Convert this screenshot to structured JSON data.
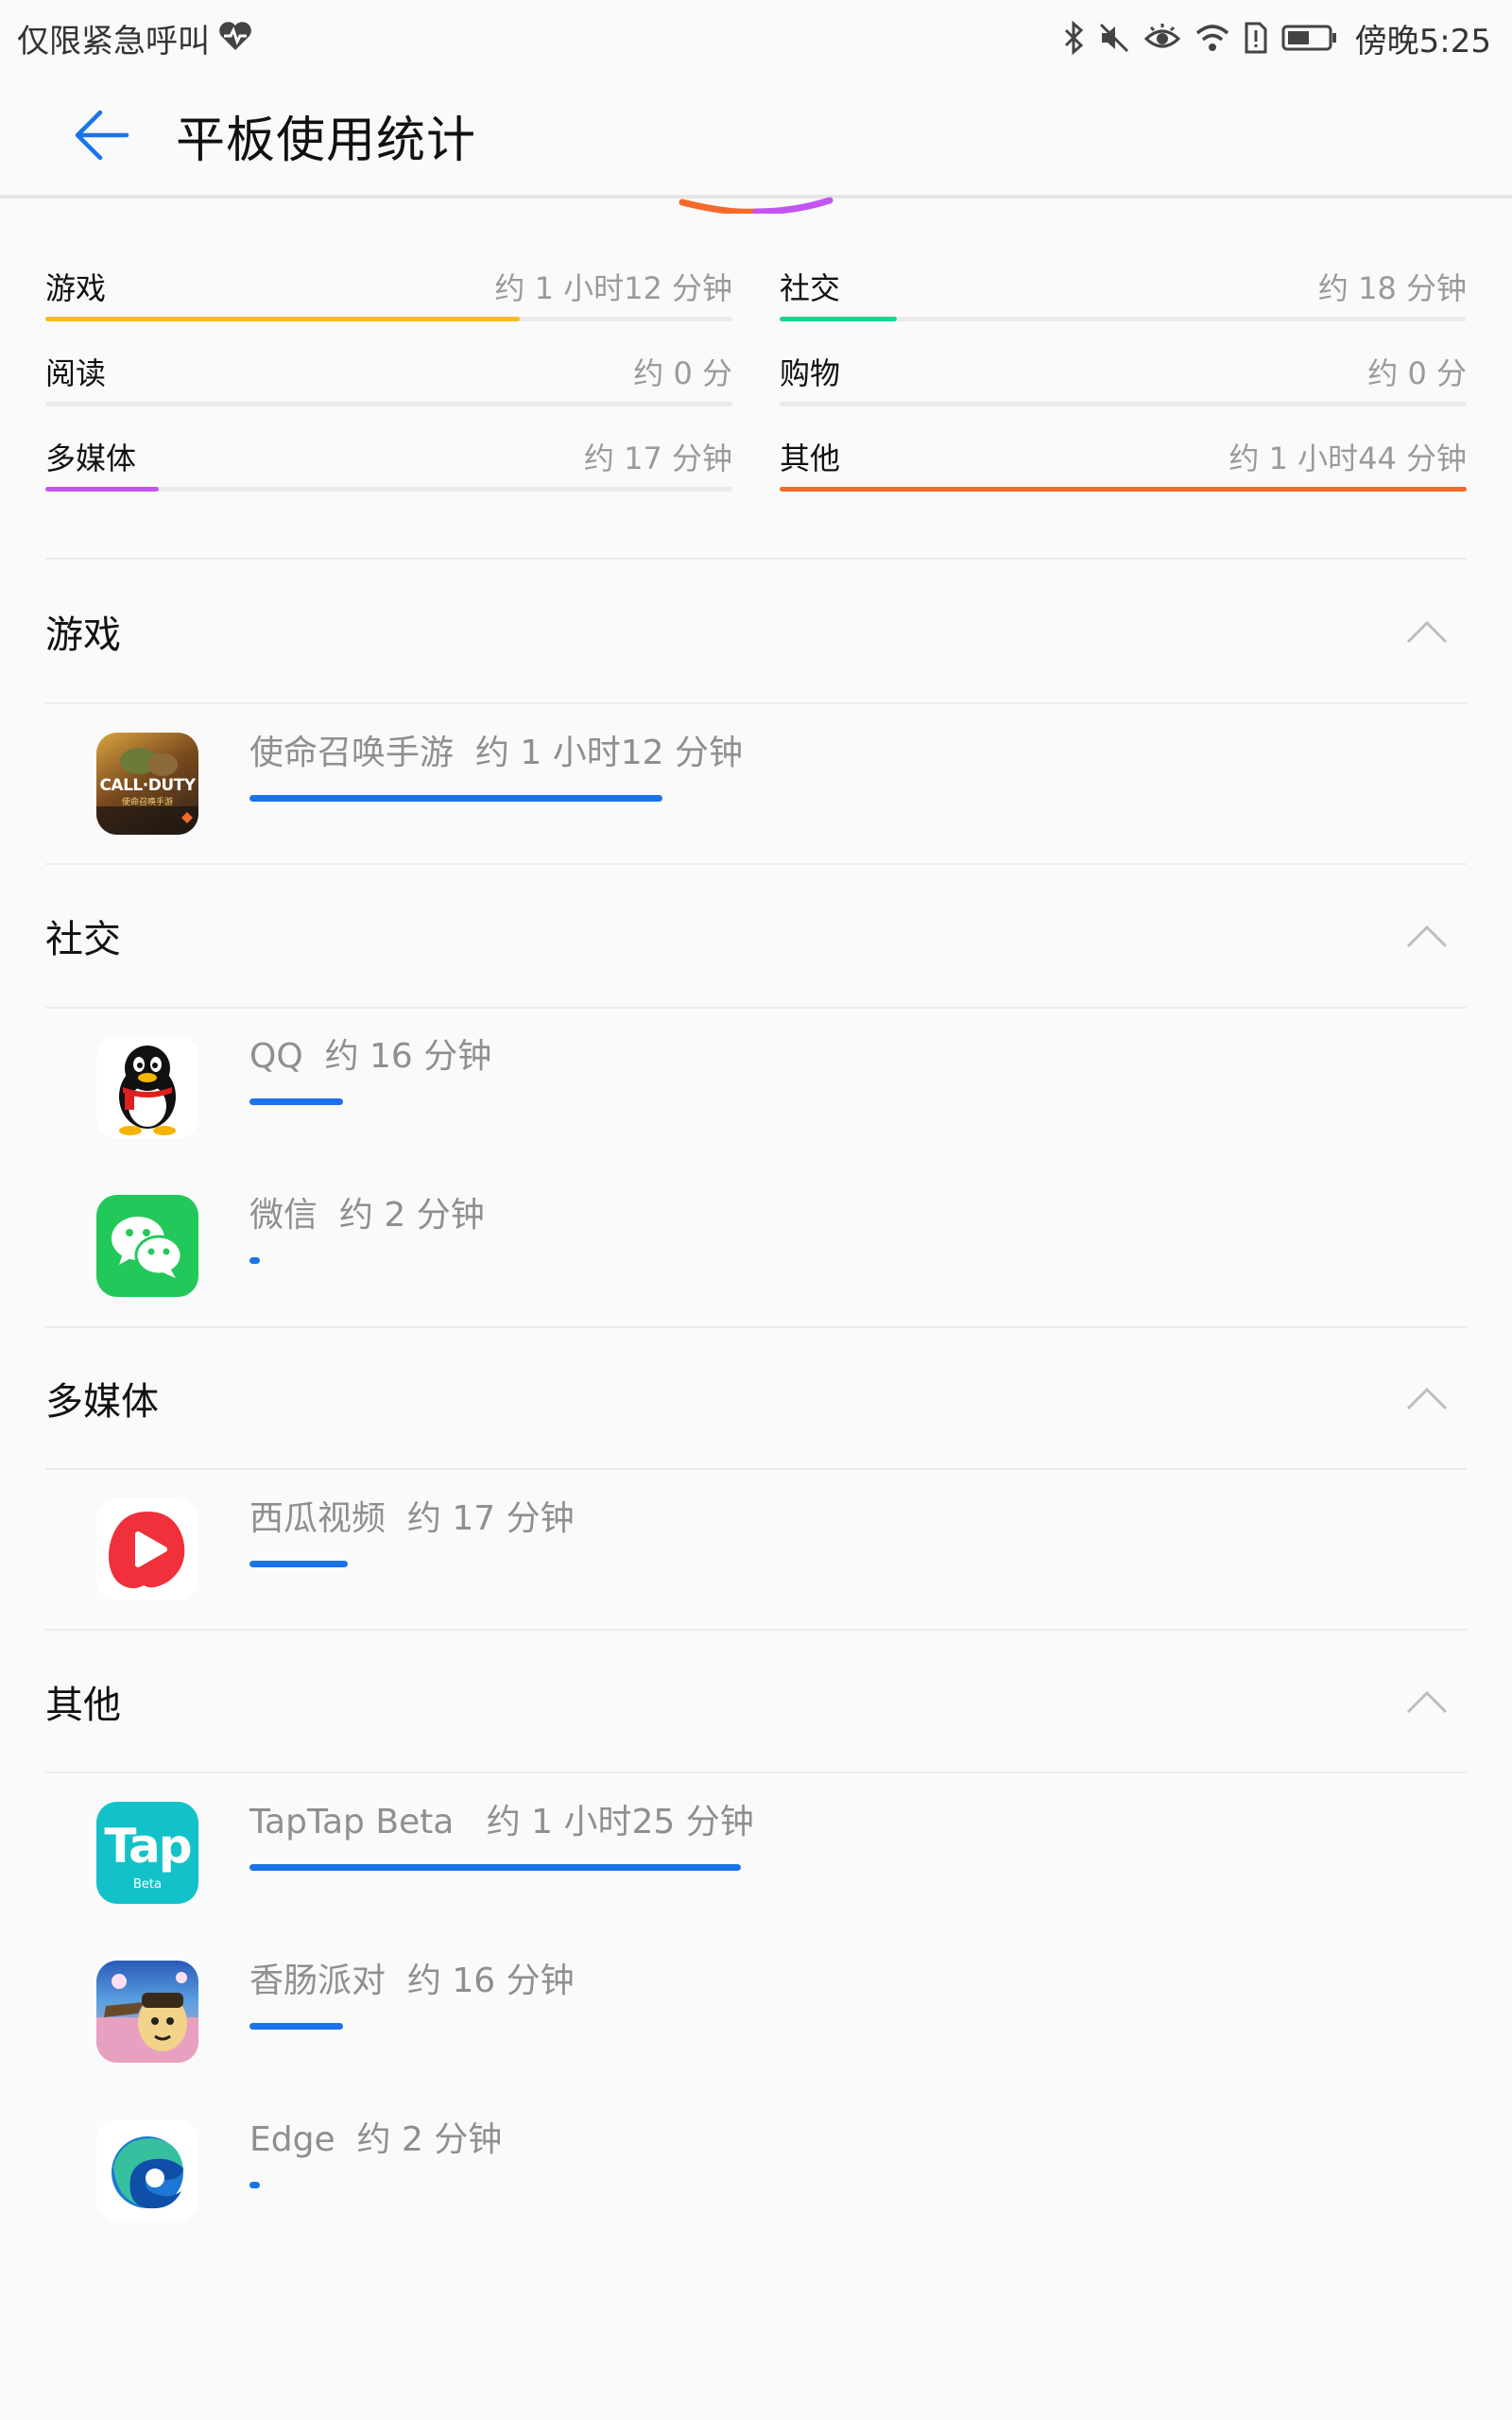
{
  "status_bar": {
    "left_text": "仅限紧急呼叫",
    "time": "傍晚5:25"
  },
  "header": {
    "title": "平板使用统计"
  },
  "categories": [
    {
      "name": "游戏",
      "duration": "约 1 小时12 分钟",
      "fraction": 0.69,
      "color": "#f9b92b"
    },
    {
      "name": "社交",
      "duration": "约 18 分钟",
      "fraction": 0.17,
      "color": "#1ed28a"
    },
    {
      "name": "阅读",
      "duration": "约 0 分",
      "fraction": 0,
      "color": "#cccccc"
    },
    {
      "name": "购物",
      "duration": "约 0 分",
      "fraction": 0,
      "color": "#cccccc"
    },
    {
      "name": "多媒体",
      "duration": "约 17 分钟",
      "fraction": 0.165,
      "color": "#c454f0"
    },
    {
      "name": "其他",
      "duration": "约 1 小时44 分钟",
      "fraction": 1.0,
      "color": "#f56a2a"
    }
  ],
  "sections": [
    {
      "title": "游戏",
      "apps": [
        {
          "name": "使命召唤手游",
          "duration": "约 1 小时12 分钟",
          "fraction": 0.84,
          "icon": "call-of-duty-icon"
        }
      ]
    },
    {
      "title": "社交",
      "apps": [
        {
          "name": "QQ",
          "duration": "约 16 分钟",
          "fraction": 0.19,
          "icon": "qq-icon"
        },
        {
          "name": "微信",
          "duration": "约 2 分钟",
          "fraction": 0.02,
          "icon": "wechat-icon"
        }
      ]
    },
    {
      "title": "多媒体",
      "apps": [
        {
          "name": "西瓜视频",
          "duration": "约 17 分钟",
          "fraction": 0.2,
          "icon": "xigua-video-icon"
        }
      ]
    },
    {
      "title": "其他",
      "apps": [
        {
          "name": "TapTap Beta",
          "duration": "约 1 小时25 分钟",
          "fraction": 1.0,
          "icon": "taptap-icon",
          "icon_text": "Tap",
          "icon_sub": "Beta"
        },
        {
          "name": "香肠派对",
          "duration": "约 16 分钟",
          "fraction": 0.19,
          "icon": "sausage-party-icon"
        },
        {
          "name": "Edge",
          "duration": "约 2 分钟",
          "fraction": 0.02,
          "icon": "edge-icon"
        }
      ]
    }
  ],
  "icon_labels": {
    "cod_line1": "CALL·DUTY",
    "cod_line2": "使命召唤手游"
  }
}
